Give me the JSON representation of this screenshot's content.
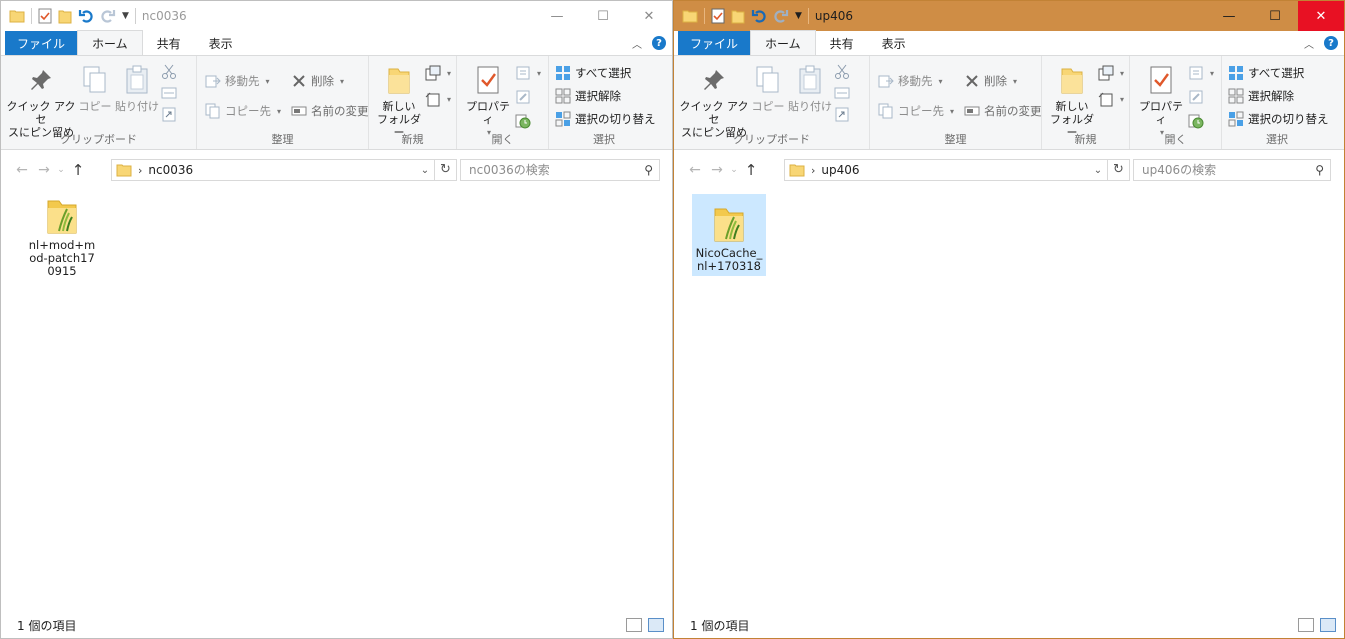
{
  "windows": [
    {
      "title": "nc0036",
      "tabs": {
        "file": "ファイル",
        "home": "ホーム",
        "share": "共有",
        "view": "表示"
      },
      "ribbon": {
        "clipboard": {
          "label": "クリップボード",
          "pin_line1": "クイック アクセ",
          "pin_line2": "スにピン留め",
          "copy": "コピー",
          "paste": "貼り付け"
        },
        "organize": {
          "label": "整理",
          "move_to": "移動先",
          "copy_to": "コピー先",
          "delete": "削除",
          "rename": "名前の変更"
        },
        "new": {
          "label": "新規",
          "new_folder_line1": "新しい",
          "new_folder_line2": "フォルダー"
        },
        "open": {
          "label": "開く",
          "properties": "プロパティ"
        },
        "select": {
          "label": "選択",
          "select_all": "すべて選択",
          "select_none": "選択解除",
          "invert": "選択の切り替え"
        }
      },
      "address": {
        "path": "nc0036"
      },
      "search": {
        "placeholder": "nc0036の検索"
      },
      "files": [
        {
          "name": "nl+mod+mod-patch170915",
          "selected": false
        }
      ],
      "status": {
        "count": "1 個の項目"
      }
    },
    {
      "title": "up406",
      "tabs": {
        "file": "ファイル",
        "home": "ホーム",
        "share": "共有",
        "view": "表示"
      },
      "ribbon": {
        "clipboard": {
          "label": "クリップボード",
          "pin_line1": "クイック アクセ",
          "pin_line2": "スにピン留め",
          "copy": "コピー",
          "paste": "貼り付け"
        },
        "organize": {
          "label": "整理",
          "move_to": "移動先",
          "copy_to": "コピー先",
          "delete": "削除",
          "rename": "名前の変更"
        },
        "new": {
          "label": "新規",
          "new_folder_line1": "新しい",
          "new_folder_line2": "フォルダー"
        },
        "open": {
          "label": "開く",
          "properties": "プロパティ"
        },
        "select": {
          "label": "選択",
          "select_all": "すべて選択",
          "select_none": "選択解除",
          "invert": "選択の切り替え"
        }
      },
      "address": {
        "path": "up406"
      },
      "search": {
        "placeholder": "up406の検索"
      },
      "files": [
        {
          "name": "NicoCache_nl+170318",
          "selected": true
        }
      ],
      "status": {
        "count": "1 個の項目"
      }
    }
  ],
  "colors": {
    "file_tab": "#1979ca",
    "active_titlebar": "#cf8d45",
    "close_hover": "#e81123",
    "selection": "#cce8ff"
  },
  "icons": {
    "folder": "folder-icon",
    "zip_folder": "compressed-folder-icon",
    "pin": "pin-icon",
    "copy": "copy-icon",
    "paste": "paste-icon",
    "cut": "scissors-icon",
    "delete": "delete-x-icon",
    "rename": "rename-icon",
    "properties": "properties-check-icon",
    "select_all": "select-all-icon",
    "search": "search-icon",
    "up": "up-arrow-icon",
    "back": "back-arrow-icon",
    "forward": "forward-arrow-icon",
    "refresh": "refresh-icon"
  }
}
